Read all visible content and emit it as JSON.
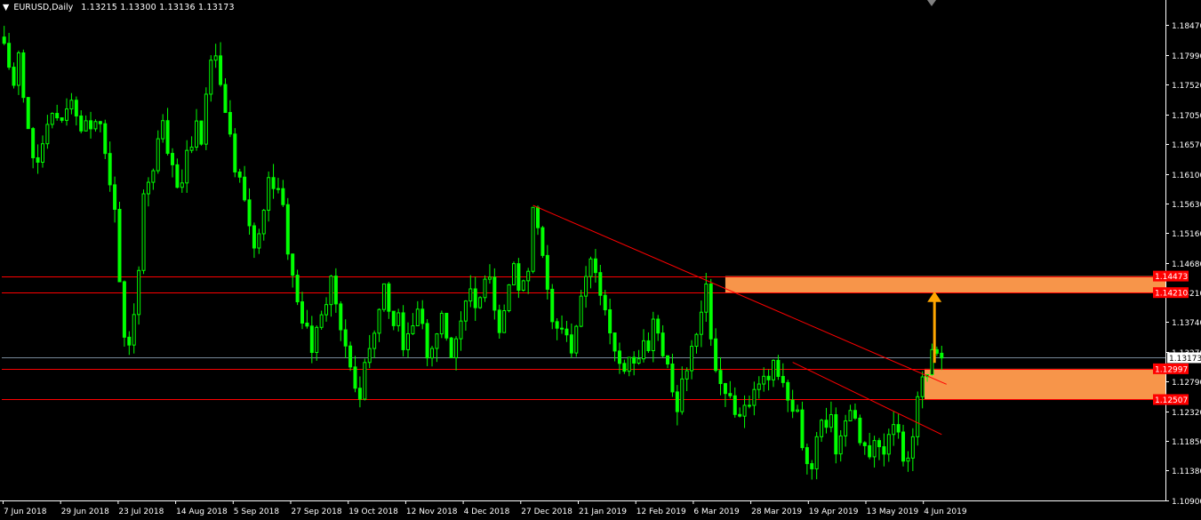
{
  "header": {
    "menu_glyph": "▼",
    "symbol_timeframe": "EURUSD,Daily",
    "ohlc": "1.13215 1.13300 1.13136 1.13173"
  },
  "colors": {
    "background": "#000000",
    "bull_candle": "#00ff00",
    "bear_candle": "#00ff00",
    "axis_text": "#ffffff",
    "level_line": "#ff0000",
    "zone_fill": "#f7954a",
    "arrow": "#ffa500",
    "bid_line": "#778899"
  },
  "chart_data": {
    "type": "candlestick",
    "title": "EURUSD,Daily",
    "y_ticks": [
      "1.18470",
      "1.17990",
      "1.17520",
      "1.17050",
      "1.16570",
      "1.16100",
      "1.15630",
      "1.15160",
      "1.14680",
      "1.14210",
      "1.13740",
      "1.13270",
      "1.12790",
      "1.12320",
      "1.11850",
      "1.11380",
      "1.10900"
    ],
    "x_ticks": [
      "7 Jun 2018",
      "29 Jun 2018",
      "23 Jul 2018",
      "14 Aug 2018",
      "5 Sep 2018",
      "27 Sep 2018",
      "19 Oct 2018",
      "12 Nov 2018",
      "4 Dec 2018",
      "27 Dec 2018",
      "21 Jan 2019",
      "12 Feb 2019",
      "6 Mar 2019",
      "28 Mar 2019",
      "19 Apr 2019",
      "13 May 2019",
      "4 Jun 2019"
    ],
    "ylim": [
      1.109,
      1.187
    ],
    "close_path": [
      [
        0,
        1.181
      ],
      [
        1,
        1.178
      ],
      [
        2,
        1.175
      ],
      [
        3,
        1.1805
      ],
      [
        4,
        1.173
      ],
      [
        5,
        1.168
      ],
      [
        6,
        1.164
      ],
      [
        7,
        1.162
      ],
      [
        8,
        1.166
      ],
      [
        9,
        1.169
      ],
      [
        10,
        1.171
      ],
      [
        11,
        1.17
      ],
      [
        12,
        1.169
      ],
      [
        13,
        1.172
      ],
      [
        14,
        1.173
      ],
      [
        15,
        1.17
      ],
      [
        16,
        1.168
      ],
      [
        17,
        1.17
      ],
      [
        18,
        1.169
      ],
      [
        19,
        1.17
      ],
      [
        20,
        1.169
      ],
      [
        21,
        1.164
      ],
      [
        22,
        1.159
      ],
      [
        23,
        1.156
      ],
      [
        24,
        1.143
      ],
      [
        25,
        1.135
      ],
      [
        26,
        1.133
      ],
      [
        27,
        1.138
      ],
      [
        28,
        1.145
      ],
      [
        29,
        1.157
      ],
      [
        30,
        1.16
      ],
      [
        31,
        1.161
      ],
      [
        32,
        1.166
      ],
      [
        33,
        1.17
      ],
      [
        34,
        1.165
      ],
      [
        35,
        1.162
      ],
      [
        36,
        1.159
      ],
      [
        37,
        1.16
      ],
      [
        38,
        1.164
      ],
      [
        39,
        1.166
      ],
      [
        40,
        1.169
      ],
      [
        41,
        1.166
      ],
      [
        42,
        1.174
      ],
      [
        43,
        1.179
      ],
      [
        44,
        1.18
      ],
      [
        45,
        1.175
      ],
      [
        46,
        1.171
      ],
      [
        47,
        1.168
      ],
      [
        48,
        1.162
      ],
      [
        49,
        1.16
      ],
      [
        50,
        1.157
      ],
      [
        51,
        1.152
      ],
      [
        52,
        1.149
      ],
      [
        53,
        1.151
      ],
      [
        54,
        1.155
      ],
      [
        55,
        1.16
      ],
      [
        56,
        1.159
      ],
      [
        57,
        1.158
      ],
      [
        58,
        1.157
      ],
      [
        59,
        1.149
      ],
      [
        60,
        1.145
      ],
      [
        61,
        1.14
      ],
      [
        62,
        1.138
      ],
      [
        63,
        1.136
      ],
      [
        64,
        1.133
      ],
      [
        65,
        1.136
      ],
      [
        66,
        1.138
      ],
      [
        67,
        1.14
      ],
      [
        68,
        1.144
      ],
      [
        69,
        1.141
      ],
      [
        70,
        1.136
      ],
      [
        71,
        1.133
      ],
      [
        72,
        1.131
      ],
      [
        73,
        1.126
      ],
      [
        74,
        1.125
      ],
      [
        75,
        1.131
      ],
      [
        76,
        1.134
      ],
      [
        77,
        1.136
      ],
      [
        78,
        1.139
      ],
      [
        79,
        1.144
      ],
      [
        80,
        1.139
      ],
      [
        81,
        1.136
      ],
      [
        82,
        1.138
      ],
      [
        83,
        1.133
      ],
      [
        84,
        1.135
      ],
      [
        85,
        1.136
      ],
      [
        86,
        1.14
      ],
      [
        87,
        1.137
      ],
      [
        88,
        1.132
      ],
      [
        89,
        1.133
      ],
      [
        90,
        1.136
      ],
      [
        91,
        1.138
      ],
      [
        92,
        1.134
      ],
      [
        93,
        1.132
      ],
      [
        94,
        1.135
      ],
      [
        95,
        1.138
      ],
      [
        96,
        1.141
      ],
      [
        97,
        1.142
      ],
      [
        98,
        1.139
      ],
      [
        99,
        1.141
      ],
      [
        100,
        1.144
      ],
      [
        101,
        1.145
      ],
      [
        102,
        1.14
      ],
      [
        103,
        1.136
      ],
      [
        104,
        1.139
      ],
      [
        105,
        1.143
      ],
      [
        106,
        1.146
      ],
      [
        107,
        1.142
      ],
      [
        108,
        1.144
      ],
      [
        109,
        1.146
      ],
      [
        110,
        1.156
      ],
      [
        111,
        1.153
      ],
      [
        112,
        1.148
      ],
      [
        113,
        1.143
      ],
      [
        114,
        1.138
      ],
      [
        115,
        1.137
      ],
      [
        116,
        1.136
      ],
      [
        117,
        1.135
      ],
      [
        118,
        1.133
      ],
      [
        119,
        1.136
      ],
      [
        120,
        1.141
      ],
      [
        121,
        1.144
      ],
      [
        122,
        1.147
      ],
      [
        123,
        1.145
      ],
      [
        124,
        1.142
      ],
      [
        125,
        1.14
      ],
      [
        126,
        1.136
      ],
      [
        127,
        1.133
      ],
      [
        128,
        1.131
      ],
      [
        129,
        1.129
      ],
      [
        130,
        1.132
      ],
      [
        131,
        1.13
      ],
      [
        132,
        1.132
      ],
      [
        133,
        1.135
      ],
      [
        134,
        1.133
      ],
      [
        135,
        1.137
      ],
      [
        136,
        1.135
      ],
      [
        137,
        1.132
      ],
      [
        138,
        1.13
      ],
      [
        139,
        1.126
      ],
      [
        140,
        1.124
      ],
      [
        141,
        1.128
      ],
      [
        142,
        1.13
      ],
      [
        143,
        1.133
      ],
      [
        144,
        1.136
      ],
      [
        145,
        1.139
      ],
      [
        146,
        1.144
      ],
      [
        147,
        1.134
      ],
      [
        148,
        1.13
      ],
      [
        149,
        1.128
      ],
      [
        150,
        1.126
      ],
      [
        151,
        1.125
      ],
      [
        152,
        1.123
      ],
      [
        153,
        1.122
      ],
      [
        154,
        1.124
      ],
      [
        155,
        1.124
      ],
      [
        156,
        1.126
      ],
      [
        157,
        1.127
      ],
      [
        158,
        1.129
      ],
      [
        159,
        1.128
      ],
      [
        160,
        1.131
      ],
      [
        161,
        1.129
      ],
      [
        162,
        1.127
      ],
      [
        163,
        1.125
      ],
      [
        164,
        1.124
      ],
      [
        165,
        1.123
      ],
      [
        166,
        1.118
      ],
      [
        167,
        1.115
      ],
      [
        168,
        1.114
      ],
      [
        169,
        1.119
      ],
      [
        170,
        1.121
      ],
      [
        171,
        1.12
      ],
      [
        172,
        1.122
      ],
      [
        173,
        1.117
      ],
      [
        174,
        1.119
      ],
      [
        175,
        1.121
      ],
      [
        176,
        1.124
      ],
      [
        177,
        1.123
      ],
      [
        178,
        1.119
      ],
      [
        179,
        1.117
      ],
      [
        180,
        1.116
      ],
      [
        181,
        1.118
      ],
      [
        182,
        1.118
      ],
      [
        183,
        1.117
      ],
      [
        184,
        1.12
      ],
      [
        185,
        1.121
      ],
      [
        186,
        1.119
      ],
      [
        187,
        1.115
      ],
      [
        188,
        1.116
      ],
      [
        189,
        1.119
      ],
      [
        190,
        1.126
      ],
      [
        191,
        1.128
      ],
      [
        192,
        1.129
      ],
      [
        193,
        1.133
      ],
      [
        194,
        1.132
      ],
      [
        195,
        1.1317
      ]
    ],
    "bars_total": 196,
    "horizontal_levels": [
      {
        "label": "1.14473",
        "price": 1.14473,
        "boxed": true
      },
      {
        "label": "1.14210",
        "price": 1.1421,
        "boxed": true
      },
      {
        "label": "1.12997",
        "price": 1.12997,
        "boxed": true
      },
      {
        "label": "1.12507",
        "price": 1.12507,
        "boxed": true
      }
    ],
    "bid": {
      "label": "1.13173",
      "price": 1.13173
    },
    "zones": [
      {
        "top": 1.14473,
        "bottom": 1.1421,
        "from_bar": 150
      },
      {
        "top": 1.12997,
        "bottom": 1.12507,
        "from_bar": 193
      }
    ],
    "trendlines": [
      {
        "from": [
          110,
          1.156
        ],
        "to": [
          196,
          1.1275
        ]
      },
      {
        "from": [
          164,
          1.131
        ],
        "to": [
          195,
          1.1195
        ]
      }
    ],
    "arrow": {
      "bar": 193.5,
      "from": 1.1309,
      "to": 1.1423
    },
    "grid": false,
    "legend": "none"
  }
}
